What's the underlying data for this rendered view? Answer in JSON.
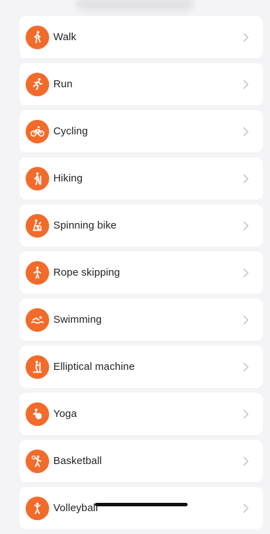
{
  "items": [
    {
      "label": "Walk",
      "icon": "walk-icon"
    },
    {
      "label": "Run",
      "icon": "run-icon"
    },
    {
      "label": "Cycling",
      "icon": "cycling-icon"
    },
    {
      "label": "Hiking",
      "icon": "hiking-icon"
    },
    {
      "label": "Spinning bike",
      "icon": "spinning-bike-icon"
    },
    {
      "label": "Rope skipping",
      "icon": "rope-skipping-icon"
    },
    {
      "label": "Swimming",
      "icon": "swimming-icon"
    },
    {
      "label": "Elliptical machine",
      "icon": "elliptical-machine-icon"
    },
    {
      "label": "Yoga",
      "icon": "yoga-icon"
    },
    {
      "label": "Basketball",
      "icon": "basketball-icon"
    },
    {
      "label": "Volleyball",
      "icon": "volleyball-icon"
    }
  ],
  "colors": {
    "accent": "#f26b2b",
    "card": "#ffffff",
    "background": "#f4f4f6",
    "text": "#222222",
    "chevron": "#c7c7cc"
  }
}
